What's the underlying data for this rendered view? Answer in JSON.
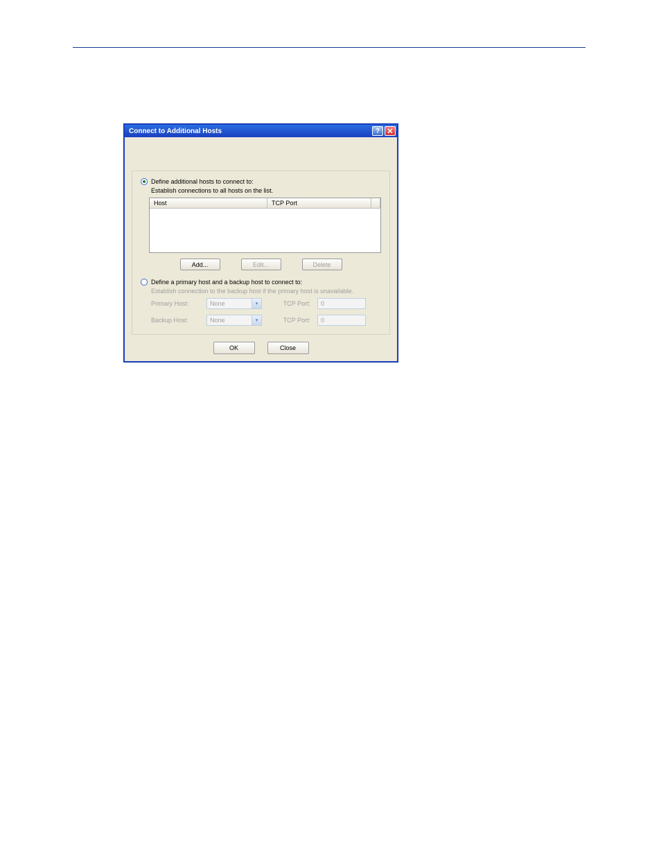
{
  "dialog": {
    "title": "Connect to Additional Hosts",
    "section1": {
      "radio_label": "Define additional hosts to connect to:",
      "subtext": "Establish connections to all hosts on the list.",
      "table": {
        "col_host": "Host",
        "col_port": "TCP Port"
      },
      "buttons": {
        "add": "Add...",
        "edit": "Edit...",
        "delete": "Delete"
      }
    },
    "section2": {
      "radio_label": "Define a primary host and a backup host to connect to:",
      "subtext": "Establish connection to the backup host if the primary host is unavailable.",
      "primary_label": "Primary Host:",
      "backup_label": "Backup Host:",
      "tcp_port_label": "TCP Port:",
      "dropdown_none": "None",
      "port_value": "0"
    },
    "footer": {
      "ok": "OK",
      "close": "Close"
    }
  }
}
